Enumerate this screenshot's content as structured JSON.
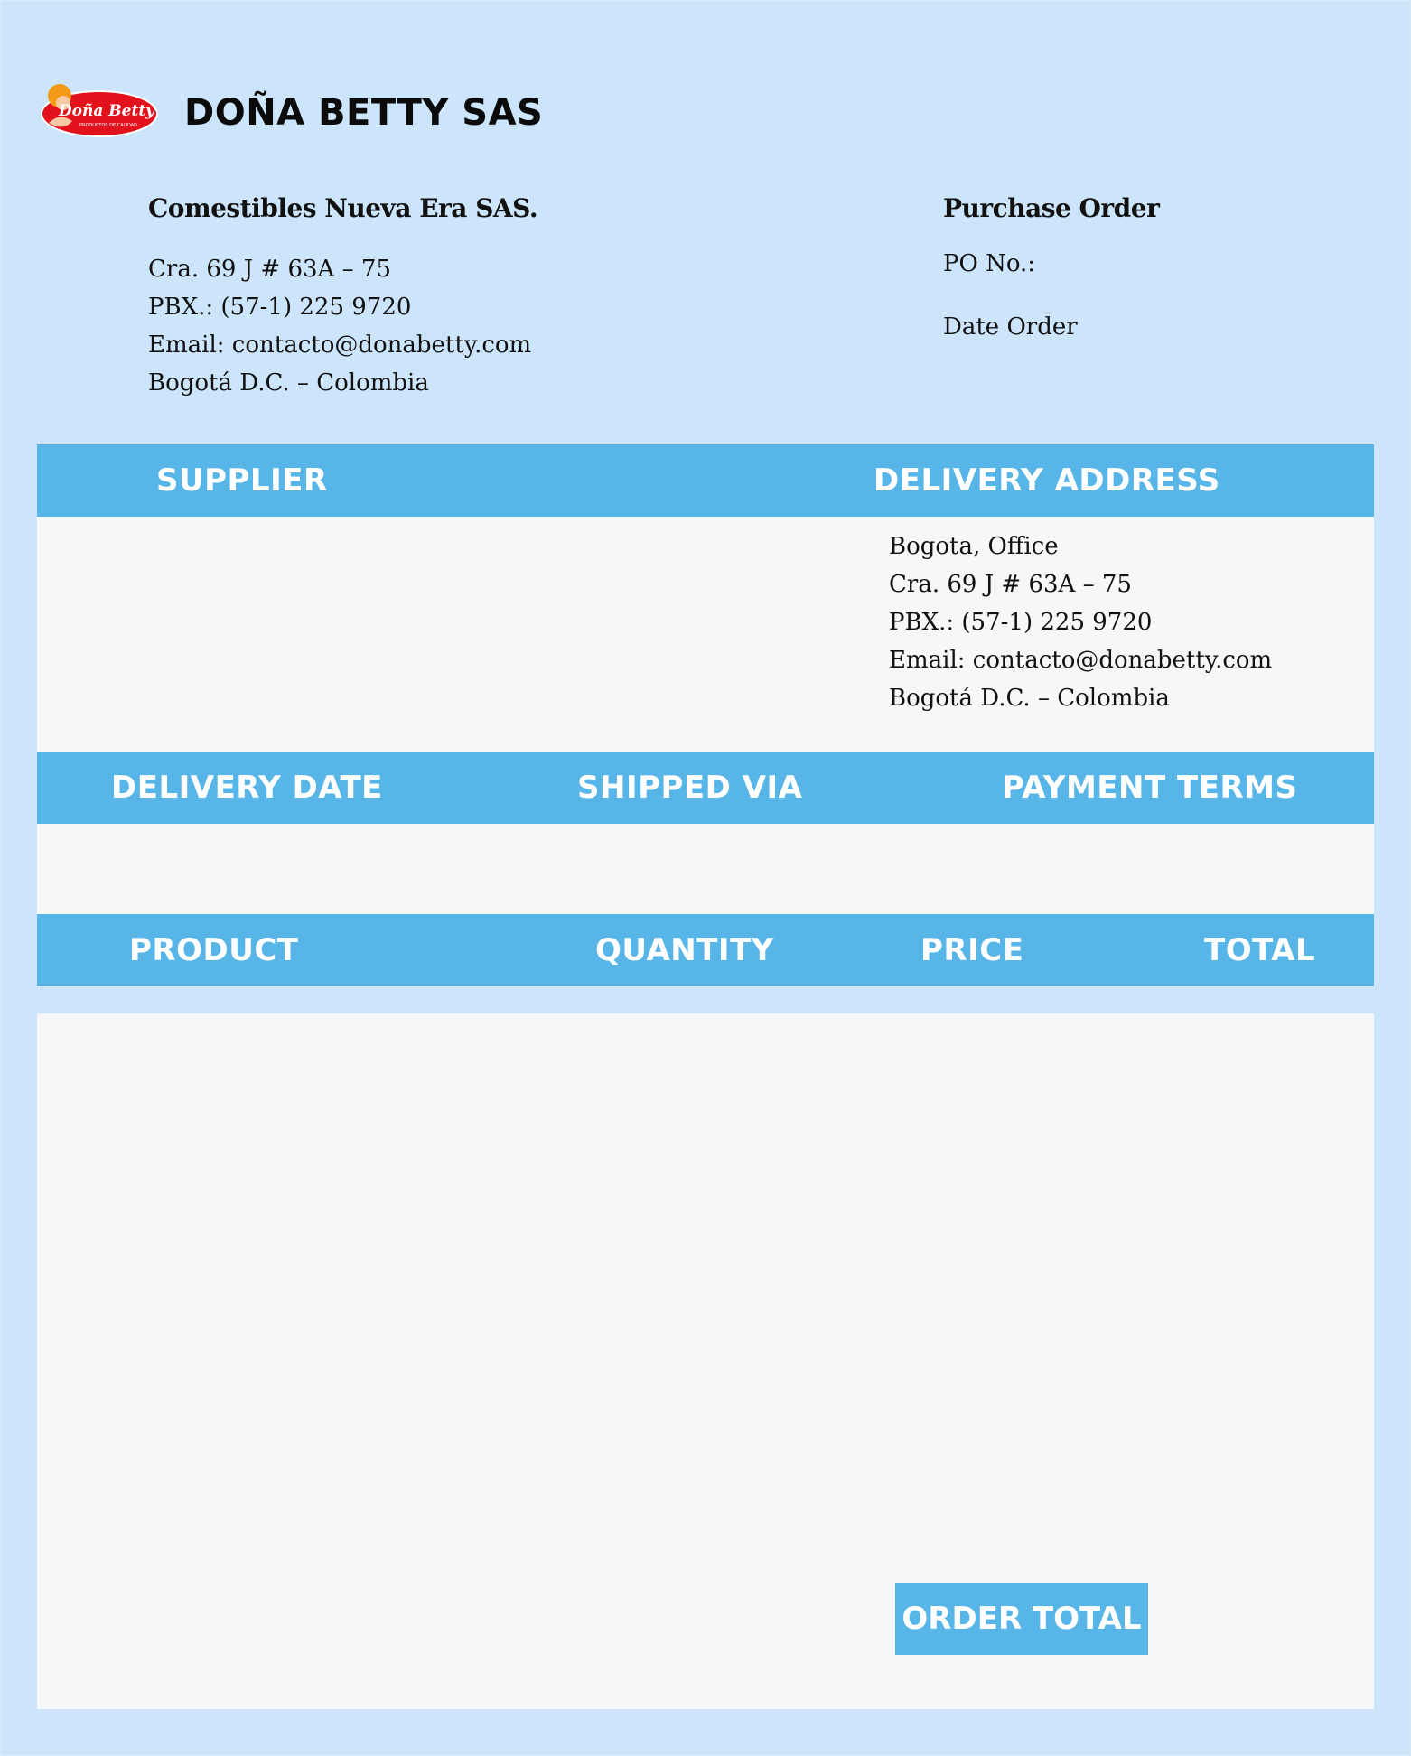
{
  "header": {
    "brand_name": "DOÑA BETTY SAS",
    "logo": {
      "icon": "dona-betty-logo",
      "text": "Doña Betty",
      "tagline": "PRODUCTOS DE CALIDAD",
      "colors": {
        "oval": "#e2121d",
        "text": "#ffffff"
      }
    }
  },
  "company": {
    "name": "Comestibles Nueva Era SAS.",
    "address": "Cra. 69 J # 63A – 75",
    "phone": "PBX.: (57-1) 225 9720",
    "email": "Email: contacto@donabetty.com",
    "city": "Bogotá D.C. – Colombia"
  },
  "purchase_order": {
    "title": "Purchase Order",
    "po_label": "PO No.:",
    "date_label": "Date Order"
  },
  "sections": {
    "supplier": "SUPPLIER",
    "delivery_address": "DELIVERY ADDRESS",
    "delivery_date": "DELIVERY DATE",
    "shipped_via": "SHIPPED VIA",
    "payment_terms": "PAYMENT TERMS",
    "product": "PRODUCT",
    "quantity": "QUANTITY",
    "price": "PRICE",
    "total": "TOTAL",
    "order_total": "ORDER TOTAL"
  },
  "delivery": {
    "office": "Bogota, Office",
    "address": "Cra. 69 J # 63A – 75",
    "phone": "PBX.: (57-1) 225 9720",
    "email": "Email: contacto@donabetty.com",
    "city": "Bogotá D.C. – Colombia"
  },
  "colors": {
    "background": "#cce5fb",
    "accent": "#57b5e7",
    "panel": "#f5f7f9"
  }
}
